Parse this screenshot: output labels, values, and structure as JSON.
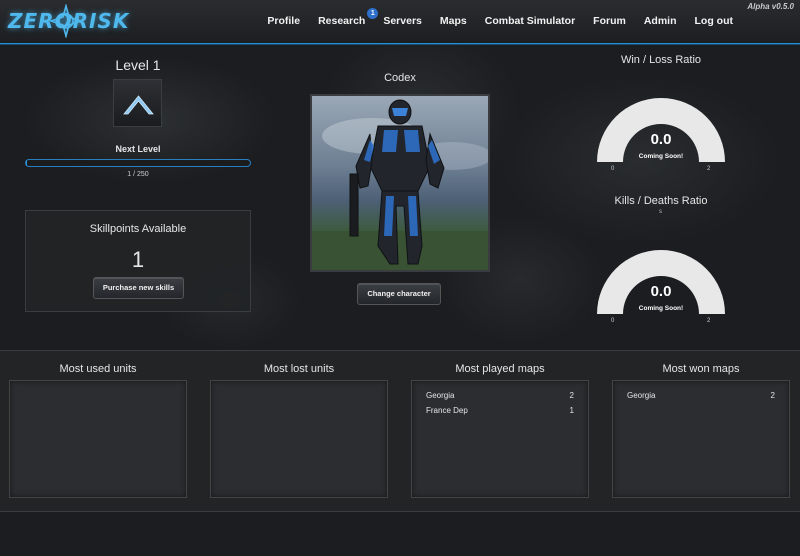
{
  "app": {
    "logo_text": "ZERORISK",
    "version": "Alpha v0.5.0"
  },
  "nav": {
    "items": [
      {
        "label": "Profile"
      },
      {
        "label": "Research",
        "badge": "1"
      },
      {
        "label": "Servers"
      },
      {
        "label": "Maps"
      },
      {
        "label": "Combat Simulator"
      },
      {
        "label": "Forum"
      },
      {
        "label": "Admin"
      },
      {
        "label": "Log out"
      }
    ]
  },
  "level": {
    "title": "Level 1",
    "rank_icon": "chevron-rank-icon",
    "next_level_label": "Next Level",
    "xp_text": "1 / 250",
    "xp_fraction": 0.004
  },
  "skillpoints": {
    "title": "Skillpoints Available",
    "count": "1",
    "button_label": "Purchase new skills"
  },
  "codex": {
    "title": "Codex",
    "button_label": "Change character"
  },
  "win_loss": {
    "title": "Win / Loss Ratio",
    "value": "0.0",
    "subtitle": "Coming Soon!",
    "min": "0",
    "max": "2"
  },
  "kill_death": {
    "title": "Kills / Deaths Ratio",
    "small_text": "s",
    "value": "0.0",
    "subtitle": "Coming Soon!",
    "min": "0",
    "max": "2"
  },
  "stats": {
    "most_used_units": {
      "title": "Most used units",
      "rows": []
    },
    "most_lost_units": {
      "title": "Most lost units",
      "rows": []
    },
    "most_played_maps": {
      "title": "Most played maps",
      "rows": [
        {
          "name": "Georgia",
          "count": "2"
        },
        {
          "name": "France Dep",
          "count": "1"
        }
      ]
    },
    "most_won_maps": {
      "title": "Most won maps",
      "rows": [
        {
          "name": "Georgia",
          "count": "2"
        }
      ]
    }
  },
  "colors": {
    "accent": "#1f8fd6",
    "gauge_fill": "#e8e8e8"
  }
}
